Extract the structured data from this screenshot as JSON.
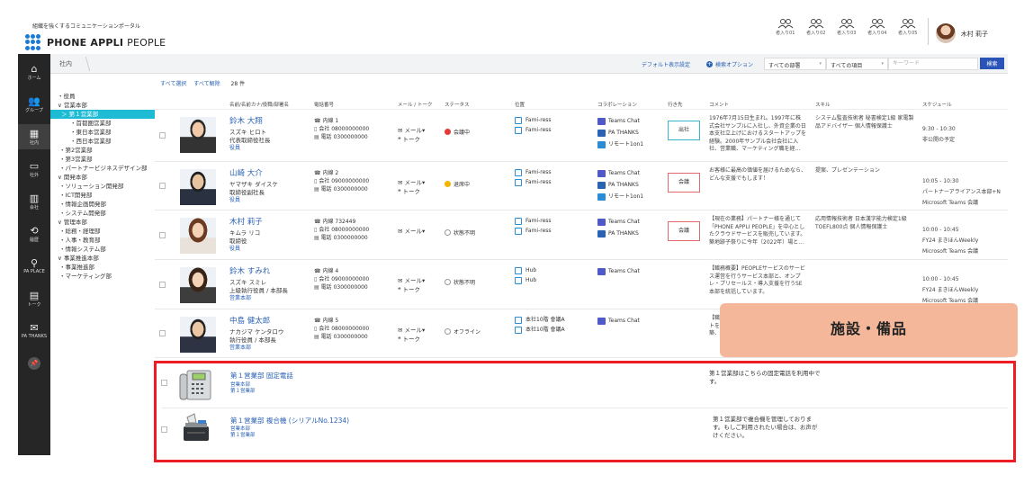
{
  "header": {
    "tagline": "組織を強くするコミュニケーションポータル",
    "logo_bold": "PHONE APPLI",
    "logo_light": "PEOPLE",
    "people_slots": [
      "者入り01",
      "者入り02",
      "者入り03",
      "者入り04",
      "者入り05"
    ],
    "user_name": "木村 莉子"
  },
  "nav": [
    {
      "label": "ホーム",
      "icon": "home-icon",
      "glyph": "⌂"
    },
    {
      "label": "グループ",
      "icon": "group-icon",
      "glyph": "👥"
    },
    {
      "label": "社内",
      "icon": "building-icon",
      "glyph": "▦"
    },
    {
      "label": "社外",
      "icon": "card-icon",
      "glyph": "▭"
    },
    {
      "label": "会社",
      "icon": "office-icon",
      "glyph": "▥"
    },
    {
      "label": "履歴",
      "icon": "history-icon",
      "glyph": "⟲"
    },
    {
      "label": "PA PLACE",
      "icon": "place-icon",
      "glyph": "⚲"
    },
    {
      "label": "トーク",
      "icon": "talk-icon",
      "glyph": "▤"
    },
    {
      "label": "PA THANKS",
      "icon": "thanks-icon",
      "glyph": "✉"
    }
  ],
  "topbar": {
    "breadcrumb": "社内",
    "default_view": "デフォルト表示設定",
    "search_option": "検索オプション",
    "dept_select": "すべての部署",
    "item_select": "すべての項目",
    "keyword_placeholder": "キーワード",
    "search_button": "検索"
  },
  "tree": [
    {
      "label": "・役員",
      "level": 0
    },
    {
      "label": "∨ 営業本部",
      "level": 0
    },
    {
      "label": "＞ 第１営業部",
      "level": 1,
      "selected": true
    },
    {
      "label": "・首都圏営業部",
      "level": 2
    },
    {
      "label": "・東日本営業部",
      "level": 2
    },
    {
      "label": "・西日本営業部",
      "level": 2
    },
    {
      "label": "・第2営業部",
      "level": 1
    },
    {
      "label": "・第3営業部",
      "level": 1
    },
    {
      "label": "・パートナービジネスデザイン部",
      "level": 1
    },
    {
      "label": "∨ 開発本部",
      "level": 0
    },
    {
      "label": "・ソリューション開発部",
      "level": 1
    },
    {
      "label": "・ICT開発部",
      "level": 1
    },
    {
      "label": "・情報企画開発部",
      "level": 1
    },
    {
      "label": "・システム開発部",
      "level": 1
    },
    {
      "label": "∨ 管理本部",
      "level": 0
    },
    {
      "label": "・総務・経理部",
      "level": 1
    },
    {
      "label": "・人事・教育部",
      "level": 1
    },
    {
      "label": "・情報システム部",
      "level": 1
    },
    {
      "label": "∨ 事業推進本部",
      "level": 0
    },
    {
      "label": "・事業推進部",
      "level": 1
    },
    {
      "label": "・マーケティング部",
      "level": 1
    }
  ],
  "results": {
    "select_all": "すべて選択",
    "clear_all": "すべて解除",
    "count": "28 件"
  },
  "columns": {
    "name": "名前/名前カナ/役職/部署名",
    "phone": "電話番号",
    "mail": "メール / トーク",
    "status": "ステータス",
    "location": "位置",
    "collab": "コラボレーション",
    "dest": "行き先",
    "comment": "コメント",
    "skill": "スキル",
    "schedule": "スケジュール"
  },
  "people": [
    {
      "name": "鈴木 大翔",
      "kana": "スズキ ヒロト",
      "title": "代表取締役社長",
      "dept": "役員",
      "phones": [
        "内線 1",
        "会社 08000000000",
        "電話 0300000000"
      ],
      "status": "会議中",
      "status_color": "#e53935",
      "loc": [
        "Fami-ress",
        "Fami-ress"
      ],
      "collab": [
        "Teams Chat",
        "PA THANKS",
        "リモート1on1"
      ],
      "dest": "出社",
      "dest_style": "teal",
      "comment": "1976年7月15日生まれ。1997年に株式会社サンプルに入社し、外資企業の日本支社立上げにおけるスタートアップを経験。2000年サンプル会社会社に入社、営業職、マーケティング職を経…",
      "skill": "システム監査技術者 秘書検定1級 家電製品アドバイザー 個人情報保護士",
      "schedule": [
        "9:30 - 10:30",
        "非公開の予定"
      ]
    },
    {
      "name": "山崎 大介",
      "kana": "ヤマザキ ダイスケ",
      "title": "取締役副社長",
      "dept": "役員",
      "phones": [
        "内線 2",
        "会社 09000000000",
        "電話 0300000000"
      ],
      "status": "退席中",
      "status_color": "#f5b400",
      "loc": [
        "Fami-ress",
        "Fami-ress"
      ],
      "collab": [
        "Teams Chat",
        "PA THANKS",
        "リモート1on1"
      ],
      "dest": "会議",
      "dest_style": "red",
      "comment": "お客様に最高の価値を届けるためなら、どんな支援でもします！",
      "skill": "提案、プレゼンテーション",
      "schedule": [
        "10:05 - 10:30",
        "パートナーアライアンス本部+N",
        "Microsoft Teams 会議"
      ]
    },
    {
      "name": "木村 莉子",
      "kana": "キムラ リコ",
      "title": "取締役",
      "dept": "役員",
      "phones": [
        "内線 732449",
        "会社 08000000000",
        "電話 0300000000"
      ],
      "status": "状態不明",
      "status_color": "",
      "loc": [
        "Fami-ress",
        "Fami-ress"
      ],
      "collab": [
        "Teams Chat",
        "PA THANKS"
      ],
      "dest": "会議",
      "dest_style": "red",
      "comment": "【現在の業務】パートナー様を通じて「PHONE APPLI PEOPLE」を中心としたクラウドサービスを販売しています。築地跡子祭りに今年（2022年）場と…",
      "skill": "応用情報技術者 日本漢字能力検定1級 TOEFL800点 個人情報保護士",
      "schedule": [
        "10:00 - 10:45",
        "FY24 まきほんWeekly",
        "Microsoft Teams 会議"
      ]
    },
    {
      "name": "鈴木 すみれ",
      "kana": "スズキ スミレ",
      "title": "上級執行役員 / 本部長",
      "dept": "営業本部",
      "phones": [
        "内線 4",
        "会社 09000000000",
        "電話 0300000000"
      ],
      "status": "状態不明",
      "status_color": "",
      "loc": [
        "Hub",
        "Hub"
      ],
      "collab": [
        "Teams Chat"
      ],
      "dest": "",
      "dest_style": "",
      "comment": "【職務概要】PEOPLEサービスのサービス運営を行うサービス本部と、オンプレ・プリセールス・導入支援を行うSE本部を統括しています。",
      "skill": "",
      "schedule": [
        "10:00 - 10:45",
        "FY24 まきほんWeekly",
        "Microsoft Teams 会議"
      ]
    },
    {
      "name": "中島 健太郎",
      "kana": "ナカジマ ケンタロウ",
      "title": "執行役員 / 本部長",
      "dept": "営業本部",
      "phones": [
        "内線 5",
        "会社 08000000000",
        "電話 0300000000"
      ],
      "status": "オフライン",
      "status_color": "",
      "loc": [
        "本社10階 會議A",
        "本社10階 會議A"
      ],
      "collab": [
        "Teams Chat"
      ],
      "dest": "",
      "dest_style": "",
      "comment": "【職務概要】スマートフォンやタブレットを活用したログラスコースの提案、構築、導入支援を行っています。全国を…",
      "skill": "",
      "schedule": []
    }
  ],
  "facility_tag": "施設・備品",
  "facilities": [
    {
      "name": "第１営業部 固定電話",
      "dept": [
        "営業本部",
        "第１営業部"
      ],
      "comment": "第１営業部はこちらの固定電話を利用中です。",
      "icon": "desk-phone-icon"
    },
    {
      "name": "第１営業部 複合機 (シリアルNo.1234)",
      "dept": [
        "営業本部",
        "第１営業部"
      ],
      "comment": "第１営業部で複合機を管理しております。もしご利用されたい場合は、お声がけください。",
      "icon": "multifunction-printer-icon"
    }
  ]
}
